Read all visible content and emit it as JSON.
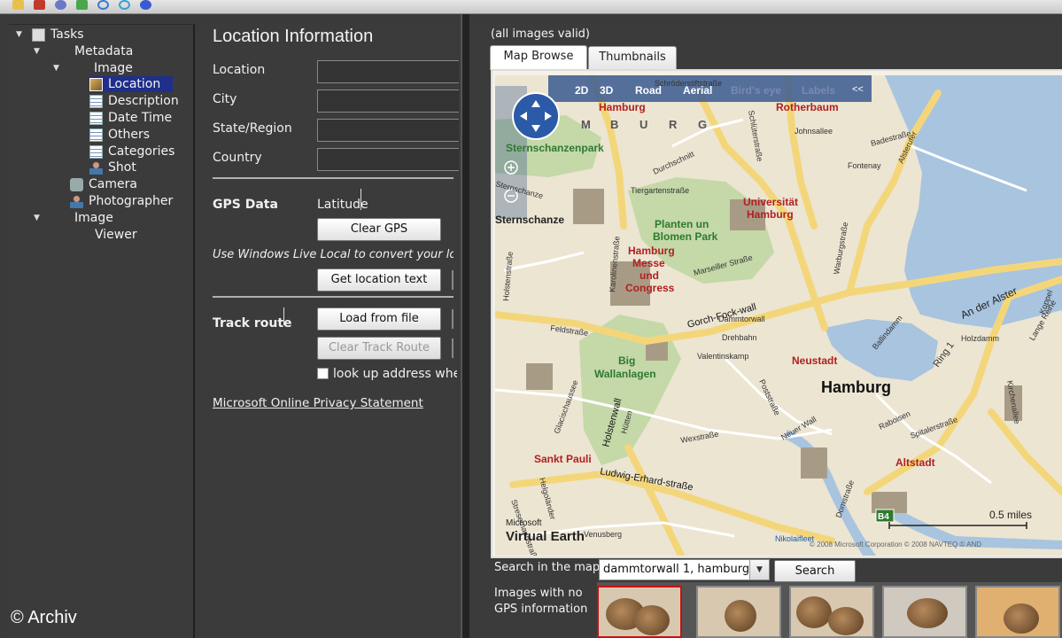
{
  "toolbar": {
    "icons": [
      "folder-icon",
      "close-icon",
      "globe-icon",
      "puzzle-icon",
      "undo-icon",
      "refresh-icon",
      "help-icon"
    ]
  },
  "tree": {
    "items": [
      {
        "label": "Tasks",
        "level": 0,
        "expanded": true,
        "icon": "clipboard-icon"
      },
      {
        "label": "Metadata",
        "level": 1,
        "expanded": true
      },
      {
        "label": "Image",
        "level": 2,
        "expanded": true
      },
      {
        "label": "Location",
        "level": 3,
        "selected": true,
        "icon": "picture-icon"
      },
      {
        "label": "Description",
        "level": 3,
        "icon": "document-icon"
      },
      {
        "label": "Date Time",
        "level": 3,
        "icon": "calendar-icon"
      },
      {
        "label": "Others",
        "level": 3,
        "icon": "document-icon"
      },
      {
        "label": "Categories",
        "level": 3,
        "icon": "document-icon"
      },
      {
        "label": "Shot",
        "level": 3,
        "icon": "person-icon"
      },
      {
        "label": "Camera",
        "level": 2,
        "icon": "camera-icon"
      },
      {
        "label": "Photographer",
        "level": 2,
        "icon": "person-icon"
      },
      {
        "label": "Image",
        "level": 1,
        "expanded": true
      },
      {
        "label": "Viewer",
        "level": 2
      }
    ]
  },
  "location": {
    "title": "Location Information",
    "fields": [
      {
        "label": "Location",
        "value": ""
      },
      {
        "label": "City",
        "value": ""
      },
      {
        "label": "State/Region",
        "value": ""
      },
      {
        "label": "Country",
        "value": ""
      }
    ],
    "gps_heading": "GPS Data",
    "latitude_label": "Latitude",
    "clear_gps": "Clear GPS",
    "convert_note": "Use Windows Live Local to convert your locat",
    "get_location_text": "Get location text",
    "track_route": "Track route",
    "load_from_file": "Load from file",
    "clear_track_route": "Clear Track Route",
    "lookup_label": "look up address when",
    "privacy_link": "Microsoft Online Privacy Statement"
  },
  "right": {
    "validity": "(all images valid)",
    "tabs": [
      "Map Browse",
      "Thumbnails"
    ],
    "search_label": "Search in the map",
    "search_value": "dammtorwall 1, hamburg,",
    "search_button": "Search",
    "no_gps_label": "Images with no GPS information"
  },
  "map": {
    "nav": {
      "d2": "2D",
      "d3": "3D",
      "road": "Road",
      "aerial": "Aerial",
      "birdseye": "Bird's eye",
      "labels": "Labels",
      "collapse": "<<"
    },
    "brand_line1": "Microsoft",
    "brand_line2": "Virtual Earth",
    "scale": "0.5 miles",
    "badge": "B4",
    "copyright": "© 2008 Microsoft Corporation  © 2008 NAVTEQ  © AND",
    "city": "Hamburg",
    "districts": [
      {
        "name": "Hamburg",
        "color": "#b02020"
      },
      {
        "name": "Rotherbaum",
        "color": "#b02020"
      },
      {
        "name": "Universität",
        "color": "#b02020"
      },
      {
        "name": "Hamburg",
        "color": "#b02020"
      },
      {
        "name": "Hamburg",
        "color": "#b02020"
      },
      {
        "name": "Messe",
        "color": "#b02020"
      },
      {
        "name": "und",
        "color": "#b02020"
      },
      {
        "name": "Congress",
        "color": "#b02020"
      },
      {
        "name": "Neustadt",
        "color": "#b02020"
      },
      {
        "name": "Altstadt",
        "color": "#b02020"
      },
      {
        "name": "Sankt Pauli",
        "color": "#b02020"
      },
      {
        "name": "Sternschanze",
        "color": "#222222"
      },
      {
        "name": "Planten un",
        "color": "#2e7a2e"
      },
      {
        "name": "Blomen Park",
        "color": "#2e7a2e"
      },
      {
        "name": "Big",
        "color": "#2e7a2e"
      },
      {
        "name": "Wallanlagen",
        "color": "#2e7a2e"
      },
      {
        "name": "Sternschanzenpark",
        "color": "#2e7a2e"
      }
    ],
    "streets": [
      "Schröderstiftstraße",
      "Schlüterstraße",
      "Johnsallee",
      "Badestraße",
      "Fontenay",
      "Alsterufer",
      "Durchschnitt",
      "Tiergartenstraße",
      "Marseiller Straße",
      "Karolinenstraße",
      "Sternschanze",
      "Feldstraße",
      "Gorch-Fock-wall",
      "Dammtorwall",
      "Drehbahn",
      "Valentinskamp",
      "Poststraße",
      "Holstenwall",
      "Glacischaussee",
      "Hütten",
      "Wexstraße",
      "Ludwig-Erhard-straße",
      "Neuer Wall",
      "Raboisen",
      "Spitalerstraße",
      "Ring 1",
      "Kirchenallee",
      "Holzdamm",
      "Lange Reihe",
      "Nikolaifleet",
      "Domstraße",
      "Venusberg",
      "Helgoländer",
      "Stresemannstraße",
      "Warburgstraße",
      "An der Alster",
      "Koppel",
      "Holstenstraße",
      "Ballindamm"
    ],
    "letters": [
      "M",
      "B",
      "U",
      "R",
      "G"
    ]
  },
  "watermark": "© Archiv"
}
